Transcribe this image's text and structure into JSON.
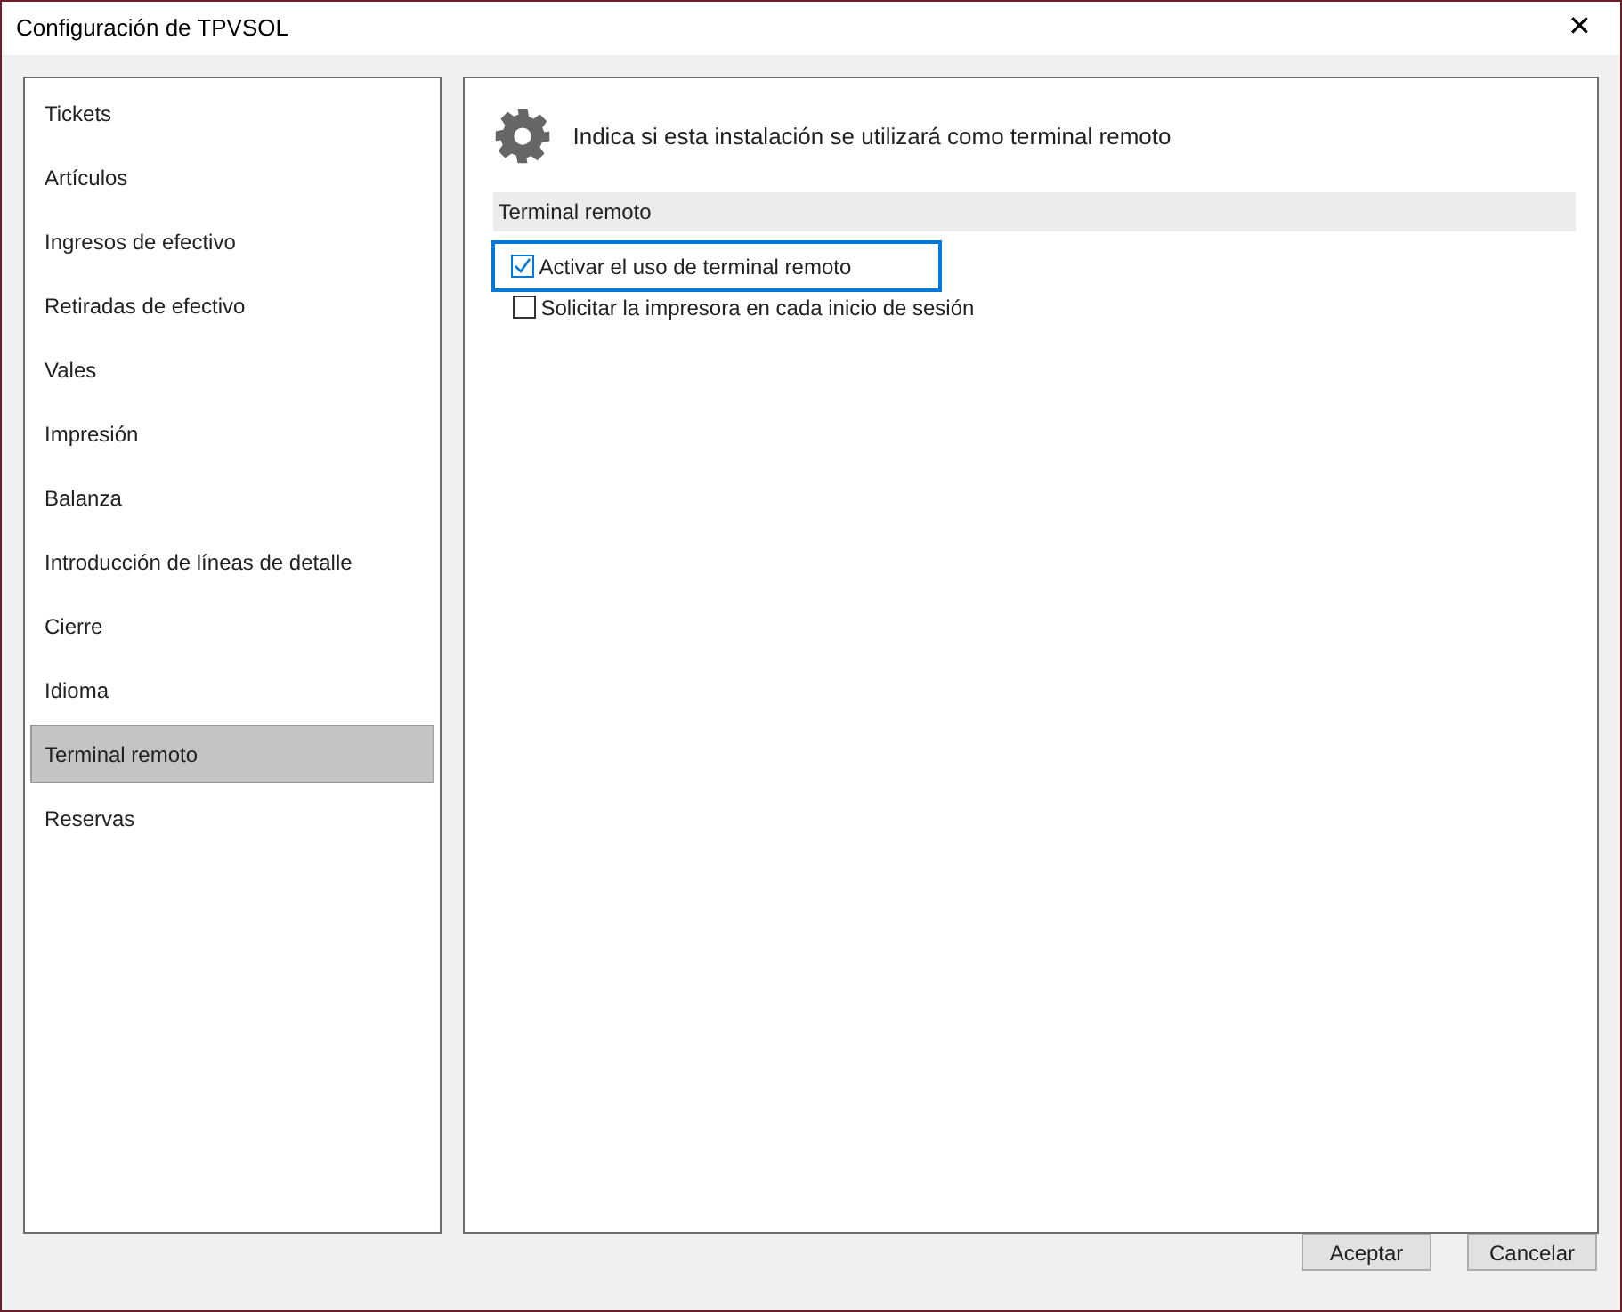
{
  "window": {
    "title": "Configuración de TPVSOL",
    "close": "✕"
  },
  "sidebar": {
    "items": [
      {
        "label": "Tickets",
        "selected": false
      },
      {
        "label": "Artículos",
        "selected": false
      },
      {
        "label": "Ingresos de efectivo",
        "selected": false
      },
      {
        "label": "Retiradas de efectivo",
        "selected": false
      },
      {
        "label": "Vales",
        "selected": false
      },
      {
        "label": "Impresión",
        "selected": false
      },
      {
        "label": "Balanza",
        "selected": false
      },
      {
        "label": "Introducción de líneas de detalle",
        "selected": false
      },
      {
        "label": "Cierre",
        "selected": false
      },
      {
        "label": "Idioma",
        "selected": false
      },
      {
        "label": "Terminal remoto",
        "selected": true
      },
      {
        "label": "Reservas",
        "selected": false
      }
    ]
  },
  "panel": {
    "description": "Indica si esta instalación se utilizará como terminal remoto",
    "section": "Terminal remoto",
    "options": [
      {
        "label": "Activar el uso de terminal remoto",
        "checked": true,
        "focused": true
      },
      {
        "label": "Solicitar la impresora en cada inicio de sesión",
        "checked": false,
        "focused": false
      }
    ]
  },
  "buttons": [
    "Aceptar",
    "Cancelar"
  ]
}
